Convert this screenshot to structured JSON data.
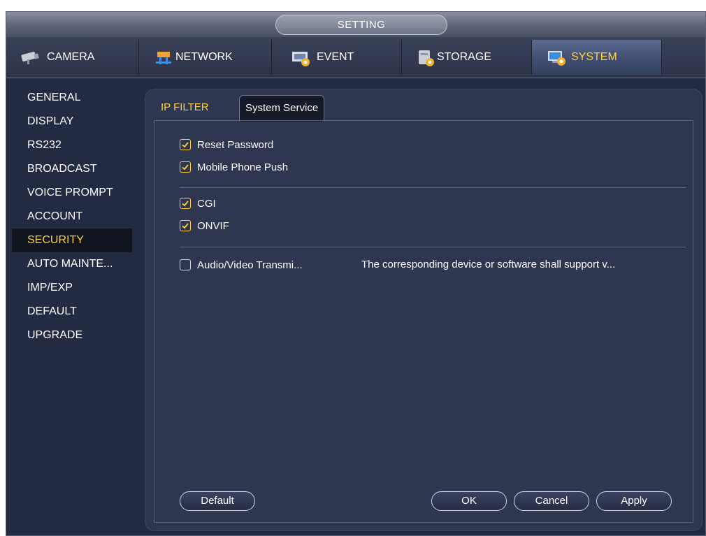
{
  "window": {
    "title": "SETTING"
  },
  "main_tabs": [
    {
      "label": "CAMERA",
      "icon": "camera-icon"
    },
    {
      "label": "NETWORK",
      "icon": "network-icon"
    },
    {
      "label": "EVENT",
      "icon": "event-icon"
    },
    {
      "label": "STORAGE",
      "icon": "storage-icon"
    },
    {
      "label": "SYSTEM",
      "icon": "system-icon",
      "active": true
    }
  ],
  "sidebar": {
    "items": [
      {
        "label": "GENERAL"
      },
      {
        "label": "DISPLAY"
      },
      {
        "label": "RS232"
      },
      {
        "label": "BROADCAST"
      },
      {
        "label": "VOICE PROMPT"
      },
      {
        "label": "ACCOUNT"
      },
      {
        "label": "SECURITY",
        "active": true
      },
      {
        "label": "AUTO MAINTE..."
      },
      {
        "label": "IMP/EXP"
      },
      {
        "label": "DEFAULT"
      },
      {
        "label": "UPGRADE"
      }
    ]
  },
  "sub_tabs": [
    {
      "label": "IP FILTER"
    },
    {
      "label": "System Service",
      "active": true
    }
  ],
  "services": {
    "reset_password": {
      "label": "Reset Password",
      "checked": true
    },
    "mobile_push": {
      "label": "Mobile Phone Push",
      "checked": true
    },
    "cgi": {
      "label": "CGI",
      "checked": true
    },
    "onvif": {
      "label": "ONVIF",
      "checked": true
    },
    "av_transmission": {
      "label": "Audio/Video Transmi...",
      "checked": false,
      "note": "The corresponding device or software shall support v..."
    }
  },
  "buttons": {
    "default": "Default",
    "ok": "OK",
    "cancel": "Cancel",
    "apply": "Apply"
  },
  "colors": {
    "accent": "#ffd23a",
    "background": "#232b42",
    "panel": "#2e3650",
    "active_sidebar": "#10141f"
  }
}
